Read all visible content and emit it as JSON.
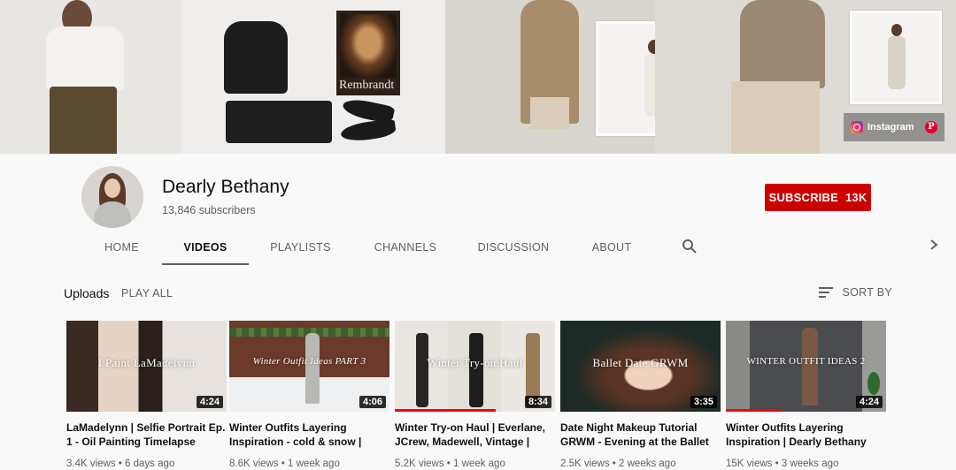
{
  "banner": {
    "book_title": "Rembrandt",
    "social": {
      "instagram_label": "Instagram",
      "pinterest_glyph": "P"
    }
  },
  "channel": {
    "name": "Dearly Bethany",
    "subscribers": "13,846 subscribers",
    "subscribe_label": "SUBSCRIBE",
    "subscribe_count": "13K",
    "accent_color": "#cc0000"
  },
  "tabs": [
    {
      "label": "HOME"
    },
    {
      "label": "VIDEOS",
      "active": true
    },
    {
      "label": "PLAYLISTS"
    },
    {
      "label": "CHANNELS"
    },
    {
      "label": "DISCUSSION"
    },
    {
      "label": "ABOUT"
    }
  ],
  "icons": {
    "search": "search-icon",
    "next": "chevron-right-icon",
    "sort": "sort-icon"
  },
  "uploads": {
    "title": "Uploads",
    "play_all": "PLAY ALL",
    "sort_by": "SORT BY"
  },
  "videos": [
    {
      "thumb_text": "I Paint LaMadelynn",
      "duration": "4:24",
      "title": "LaMadelynn | Selfie Portrait Ep. 1 - Oil Painting Timelapse",
      "meta": "3.4K views • 6 days ago",
      "watched_fraction": 0
    },
    {
      "thumb_text": "Winter Outfit Ideas PART 3",
      "duration": "4:06",
      "title": "Winter Outfits Layering Inspiration - cold & snow |",
      "meta": "8.6K views • 1 week ago",
      "watched_fraction": 0
    },
    {
      "thumb_text": "Winter Try-on Haul",
      "duration": "8:34",
      "title": "Winter Try-on Haul | Everlane, JCrew, Madewell, Vintage |",
      "meta": "5.2K views • 1 week ago",
      "watched_fraction": 0.63
    },
    {
      "thumb_text": "Ballet Date GRWM",
      "duration": "3:35",
      "title": "Date Night Makeup Tutorial GRWM - Evening at the Ballet",
      "meta": "2.5K views • 2 weeks ago",
      "watched_fraction": 0
    },
    {
      "thumb_text": "WINTER OUTFIT IDEAS 2",
      "duration": "4:24",
      "title": "Winter Outfits Layering Inspiration | Dearly Bethany",
      "meta": "15K views • 3 weeks ago",
      "watched_fraction": 0.34
    }
  ]
}
